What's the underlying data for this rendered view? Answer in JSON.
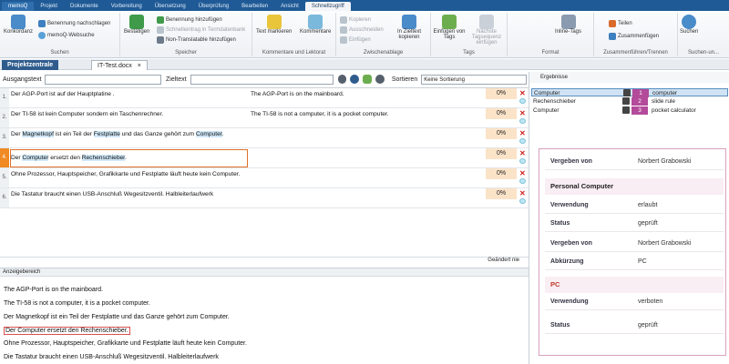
{
  "menu": {
    "app_tab": "memoQ",
    "tabs": [
      "Projekt",
      "Dokumente",
      "Vorbereitung",
      "Übersetzung",
      "Überprüfung",
      "Bearbeiten",
      "Ansicht",
      "Schnellzugriff"
    ]
  },
  "ribbon": {
    "konkordanz": "Konkordanz",
    "benennung_nachschlagen": "Benennung nachschlagen",
    "memoq_websuche": "memoQ-Websuche",
    "suchen_label": "Suchen",
    "bestaetigen": "Bestätigen",
    "benennung_hinzufuegen": "Benennung hinzufügen",
    "schnelleintrag": "Schnelleintrag in Termdatenbank",
    "non_translatable": "Non-Translatable hinzufügen",
    "speicher_label": "Speicher",
    "text_markieren": "Text markieren",
    "kommentare": "Kommentare",
    "kommentare_label": "Kommentare und Lektorat",
    "kopieren": "Kopieren",
    "ausschneiden": "Ausschneiden",
    "einfuegen": "Einfügen",
    "in_zieltext_kopieren": "In Zieltext kopieren",
    "zwischenablage_label": "Zwischenablage",
    "einfuegen_von_tags": "Einfügen von Tags",
    "naechste_tag": "Nächste Tagsequenz einfügen",
    "tags_label": "Tags",
    "inline_tags": "Inline-Tags",
    "format_label": "Format",
    "teilen": "Teilen",
    "zusammenfuegen": "Zusammenfügen",
    "zusammen_label": "Zusammenführen/Trennen",
    "suchen_btn": "Suchen",
    "suchen_un_label": "Suchen-un..."
  },
  "doctabs": {
    "projektzentrale": "Projektzentrale",
    "it_test": "IT-Test.docx",
    "close": "×"
  },
  "filter": {
    "ausgangstext_label": "Ausgangstext",
    "zieltext_label": "Zieltext",
    "sortieren_label": "Sortieren",
    "sort_value": "Keine Sortierung"
  },
  "rows": [
    {
      "n": "1.",
      "src": "Der AGP-Port ist auf der Hauptplatine .",
      "tgt": "The AGP-Port is on the mainboard.",
      "pct": "0%"
    },
    {
      "n": "2.",
      "src": "Der TI-58 ist kein Computer sondern ein Taschenrechner.",
      "tgt": "The TI-58 is not a computer, it is a pocket computer.",
      "pct": "0%"
    },
    {
      "n": "3.",
      "src_a": "Der ",
      "src_b": "Magnetkopf",
      "src_c": " ist ein Teil der ",
      "src_d": "Festplatte",
      "src_e": " und das Ganze gehört zum ",
      "src_f": "Computer",
      "src_g": ".",
      "tgt": "",
      "pct": "0%"
    },
    {
      "n": "4.",
      "src_a": "Der ",
      "src_b": "Computer",
      "src_c": " ersetzt den ",
      "src_d": "Rechenschieber",
      "src_e": ".",
      "tgt": "",
      "pct": "0%"
    },
    {
      "n": "5.",
      "src": "Ohne Prozessor, Hauptspeicher, Grafikkarte und Festplatte läuft heute kein Computer.",
      "tgt": "",
      "pct": "0%"
    },
    {
      "n": "6.",
      "src": "Die Tastatur braucht einen USB-Anschluß Wegesitzventil.  Halbleiterlaufwerk",
      "tgt": "",
      "pct": "0%"
    }
  ],
  "status": {
    "text": "Geändert  nie"
  },
  "anzeige": {
    "header": "Anzeigebereich",
    "lines": [
      "The AGP-Port is on the mainboard.",
      "The TI-58 is not a computer, it is a pocket computer.",
      "Der Magnetkopf ist ein Teil der Festplatte und das Ganze gehört zum Computer.",
      "Der Computer ersetzt den Rechenschieber.",
      "Ohne Prozessor, Hauptspeicher, Grafikkarte und Festplatte läuft heute kein Computer.",
      "Die Tastatur braucht einen USB-Anschluß Wegesitzventil.  Halbleiterlaufwerk"
    ]
  },
  "results": {
    "header": "Ergebnisse",
    "items": [
      {
        "term": "Computer",
        "num": "1",
        "trans": "computer"
      },
      {
        "term": "Rechenschieber",
        "num": "2",
        "trans": "slide rule"
      },
      {
        "term": "Computer",
        "num": "3",
        "trans": "pocket calculator"
      }
    ]
  },
  "termcard": {
    "vergeben_von_1": "Vergeben von",
    "vergeben_von_1_val": "Norbert Grabowski",
    "entry1_title": "Personal Computer",
    "verwendung": "Verwendung",
    "verwendung_val": "erlaubt",
    "status": "Status",
    "status_val": "geprüft",
    "vergeben_von_2": "Vergeben von",
    "vergeben_von_2_val": "Norbert Grabowski",
    "abkuerzung": "Abkürzung",
    "abkuerzung_val": "PC",
    "entry2_title": "PC",
    "verwendung2": "Verwendung",
    "verwendung2_val": "verboten",
    "status2": "Status",
    "status2_val": "geprüft"
  },
  "colors": {
    "accent": "#1f5a96",
    "current_row": "#f08a24",
    "match_bg": "#fbe3c8",
    "term_highlight": "#cfe7f7",
    "tb_purple": "#b34a9a"
  }
}
